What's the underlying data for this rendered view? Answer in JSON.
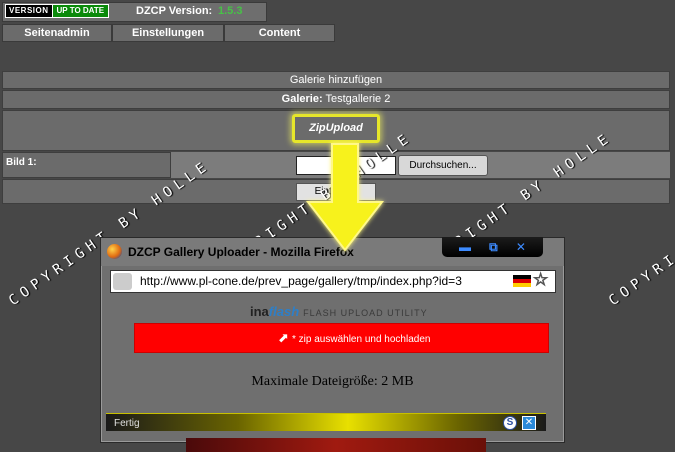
{
  "header": {
    "badge_version": "VERSION",
    "badge_status": "UP TO DATE",
    "dzcp_label": "DZCP Version:",
    "dzcp_version": "1.5.3"
  },
  "nav": [
    "Seitenadmin",
    "Einstellungen",
    "Content"
  ],
  "form": {
    "heading": "Galerie hinzufügen",
    "gallery_label": "Galerie:",
    "gallery_name": "Testgallerie 2",
    "zip_button": "ZipUpload",
    "image_label": "Bild 1:",
    "browse_button": "Durchsuchen...",
    "submit_button": "Eintragen"
  },
  "watermark": "COPYRIGHT BY HOLLE",
  "popup": {
    "title": "DZCP Gallery Uploader - Mozilla Firefox",
    "url": "http://www.pl-cone.de/prev_page/gallery/tmp/index.php?id=3",
    "brand_a": "ina",
    "brand_b": "flash",
    "brand_tagline": "FLASH UPLOAD UTILITY",
    "upload_hint": "* zip auswählen und hochladen",
    "max_size": "Maximale Dateigröße: 2 MB",
    "status": "Fertig"
  },
  "colors": {
    "background": "#474747",
    "highlight": "#e6e62a",
    "upload_bar": "#ff0000",
    "version_green": "#47c247"
  },
  "icons": [
    "firefox-icon",
    "minimize-icon",
    "restore-icon",
    "close-icon",
    "site-identity-icon",
    "german-flag-icon",
    "bookmark-star-icon",
    "cursor-icon",
    "addon-s-icon",
    "addon-x-icon",
    "arrow-down-icon"
  ]
}
